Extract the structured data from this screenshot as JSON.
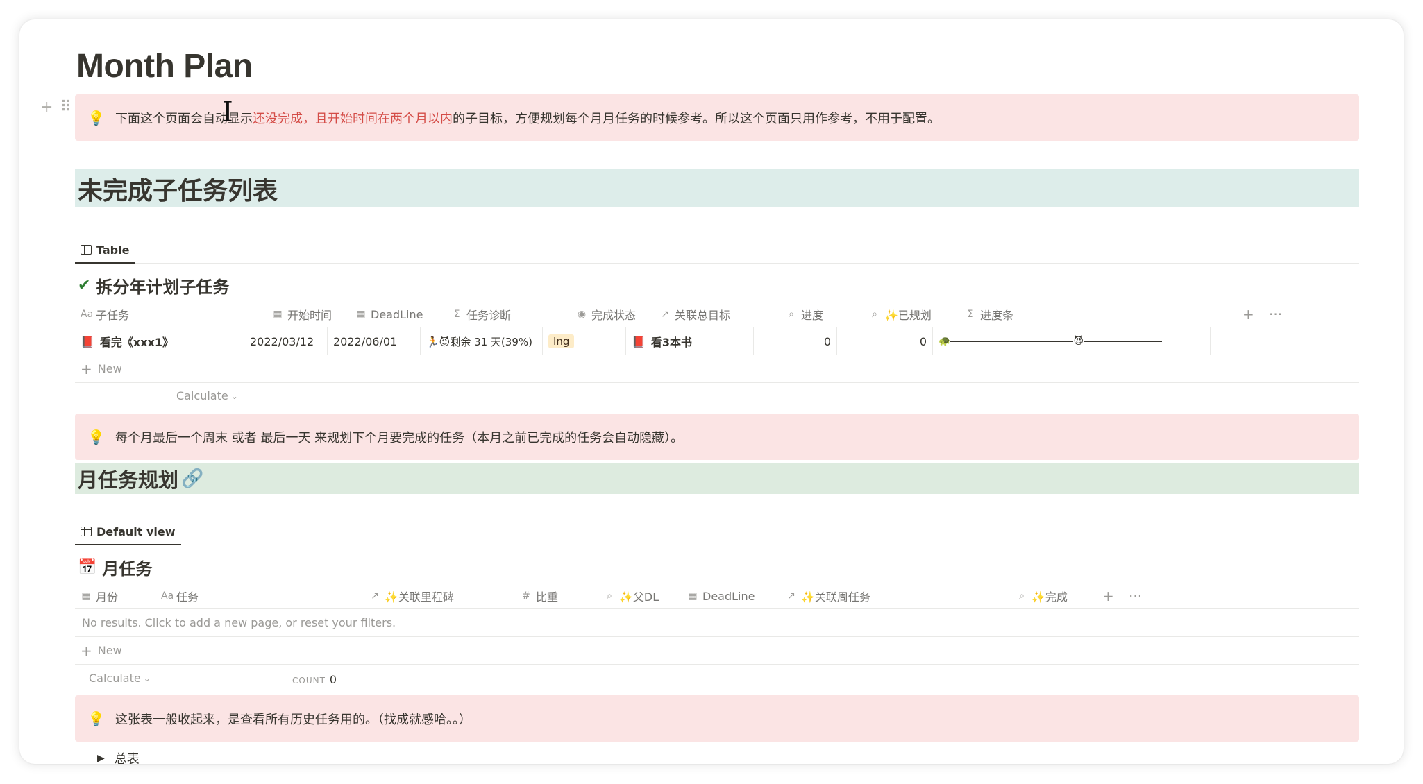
{
  "page": {
    "title": "Month Plan"
  },
  "callout1": {
    "icon": "lightbulb-icon",
    "text_before": "下面这个页面会自动显示",
    "text_red": "还没完成，且开始时间在两个月以内",
    "text_after": "的子目标，方便规划每个月月任务的时候参考。所以这个页面只用作参考，不用于配置。"
  },
  "section1": {
    "heading": "未完成子任务列表",
    "tab_label": "Table",
    "db_title": "拆分年计划子任务",
    "db_emoji": "✔️",
    "columns": [
      {
        "icon": "Aa",
        "label": "子任务"
      },
      {
        "icon": "▦",
        "label": "开始时间"
      },
      {
        "icon": "▦",
        "label": "DeadLine"
      },
      {
        "icon": "Σ",
        "label": "任务诊断"
      },
      {
        "icon": "◉",
        "label": "完成状态"
      },
      {
        "icon": "↗",
        "label": "关联总目标"
      },
      {
        "icon": "⌕",
        "label": "进度"
      },
      {
        "icon": "⌕",
        "label": "✨已规划"
      },
      {
        "icon": "Σ",
        "label": "进度条"
      }
    ],
    "rows": [
      {
        "task_emoji": "📕",
        "task": "看完《xxx1》",
        "start": "2022/03/12",
        "deadline": "2022/06/01",
        "diagnosis": "🏃😈剩余 31 天(39%)",
        "status": "Ing",
        "goal_emoji": "📕",
        "goal": "看3本书",
        "progress": "0",
        "planned": "0",
        "bar_start_emoji": "🐢",
        "bar_marker_emoji": "😈",
        "bar_fraction": 0.61
      }
    ],
    "new_label": "New",
    "calculate_label": "Calculate"
  },
  "callout2": {
    "icon": "lightbulb-icon",
    "text": "每个月最后一个周末 或者 最后一天 来规划下个月要完成的任务（本月之前已完成的任务会自动隐藏）。"
  },
  "section2": {
    "heading": "月任务规划",
    "tab_label": "Default view",
    "db_title": "月任务",
    "db_emoji": "📅",
    "columns": [
      {
        "icon": "▦",
        "label": "月份"
      },
      {
        "icon": "Aa",
        "label": "任务"
      },
      {
        "icon": "↗",
        "label": "✨关联里程碑"
      },
      {
        "icon": "#",
        "label": "比重"
      },
      {
        "icon": "⌕",
        "label": "✨父DL"
      },
      {
        "icon": "▦",
        "label": "DeadLine"
      },
      {
        "icon": "↗",
        "label": "✨关联周任务"
      },
      {
        "icon": "⌕",
        "label": "✨完成"
      }
    ],
    "no_results": "No results. Click to add a new page, or reset your filters.",
    "new_label": "New",
    "calculate_label": "Calculate",
    "count_label": "COUNT",
    "count_value": "0"
  },
  "callout3": {
    "icon": "lightbulb-icon",
    "text": "这张表一般收起来，是查看所有历史任务用的。（找成就感哈。。）"
  },
  "toggle": {
    "label": "总表"
  }
}
